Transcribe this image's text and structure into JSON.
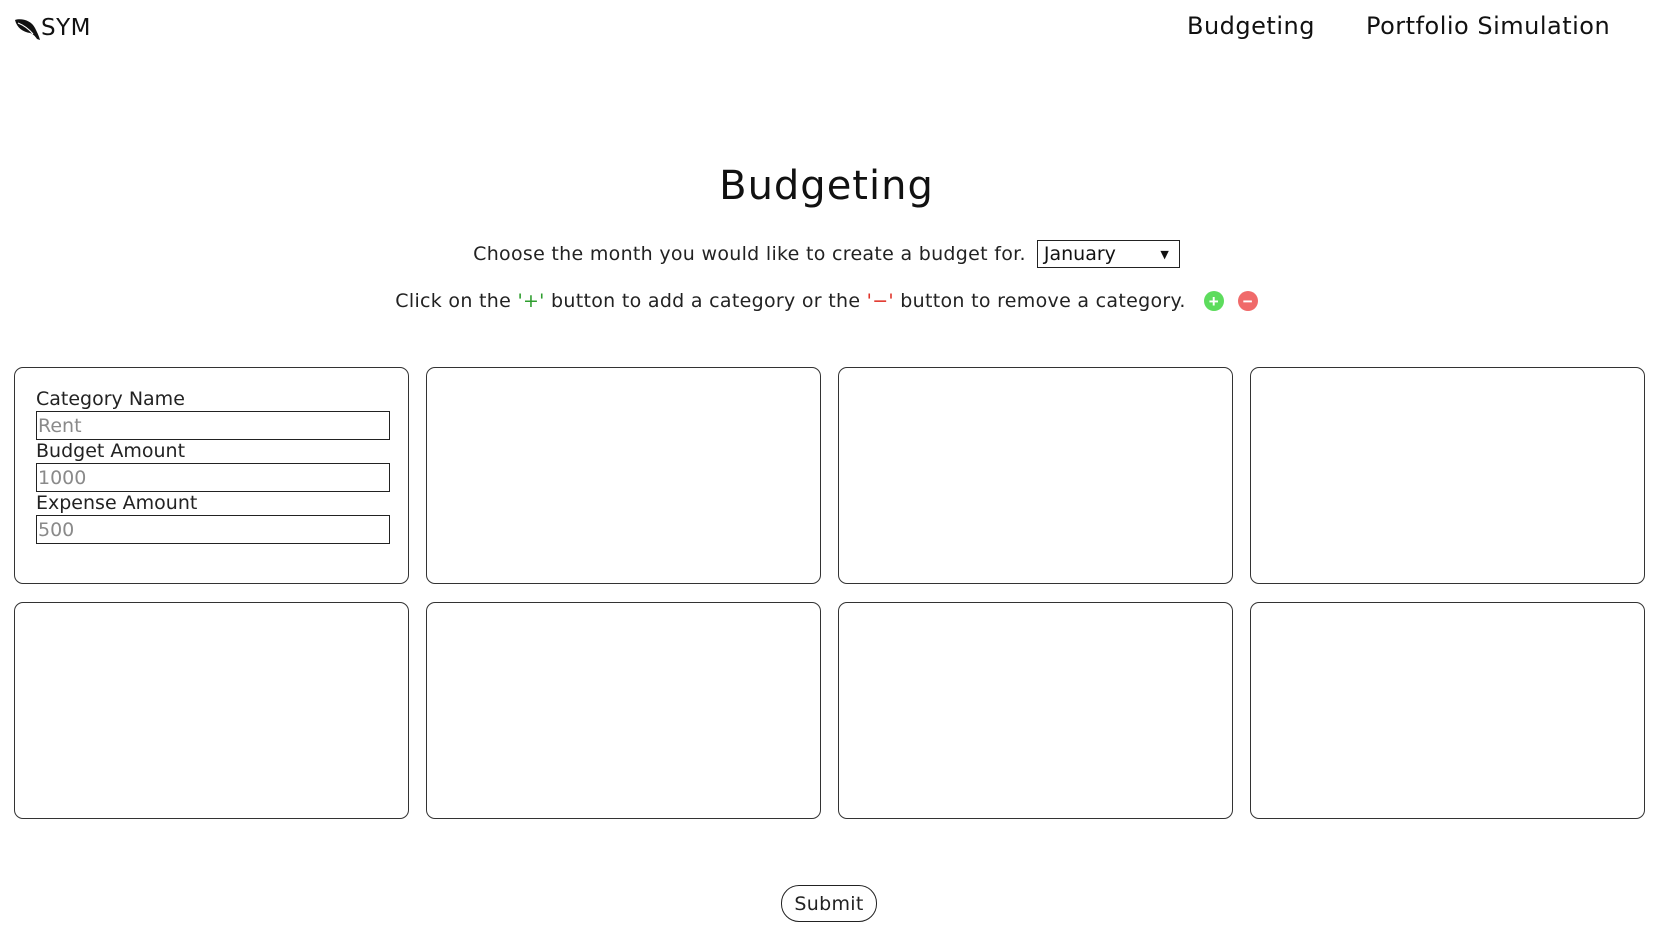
{
  "header": {
    "logo_text": "SYM",
    "nav": [
      {
        "label": "Budgeting"
      },
      {
        "label": "Portfolio Simulation"
      }
    ]
  },
  "main": {
    "title": "Budgeting",
    "month_prompt": "Choose the month you would like to create a budget for.",
    "month_select": {
      "selected": "January"
    },
    "help_text_before": "Click on the ",
    "help_plus": "'+'",
    "help_text_middle": " button to add a category or the ",
    "help_minus": "'−'",
    "help_text_after": " button to remove a category.",
    "add_button_icon": "plus-circle-icon",
    "remove_button_icon": "minus-circle-icon"
  },
  "categories": [
    {
      "name_label": "Category Name",
      "name_placeholder": "Rent",
      "budget_label": "Budget Amount",
      "budget_placeholder": "1000",
      "expense_label": "Expense Amount",
      "expense_placeholder": "500"
    }
  ],
  "submit_label": "Submit",
  "colors": {
    "add_button": "#5ddc5d",
    "remove_button": "#f06a6a",
    "plus_text": "#2e9e2e",
    "minus_text": "#e0342a"
  }
}
